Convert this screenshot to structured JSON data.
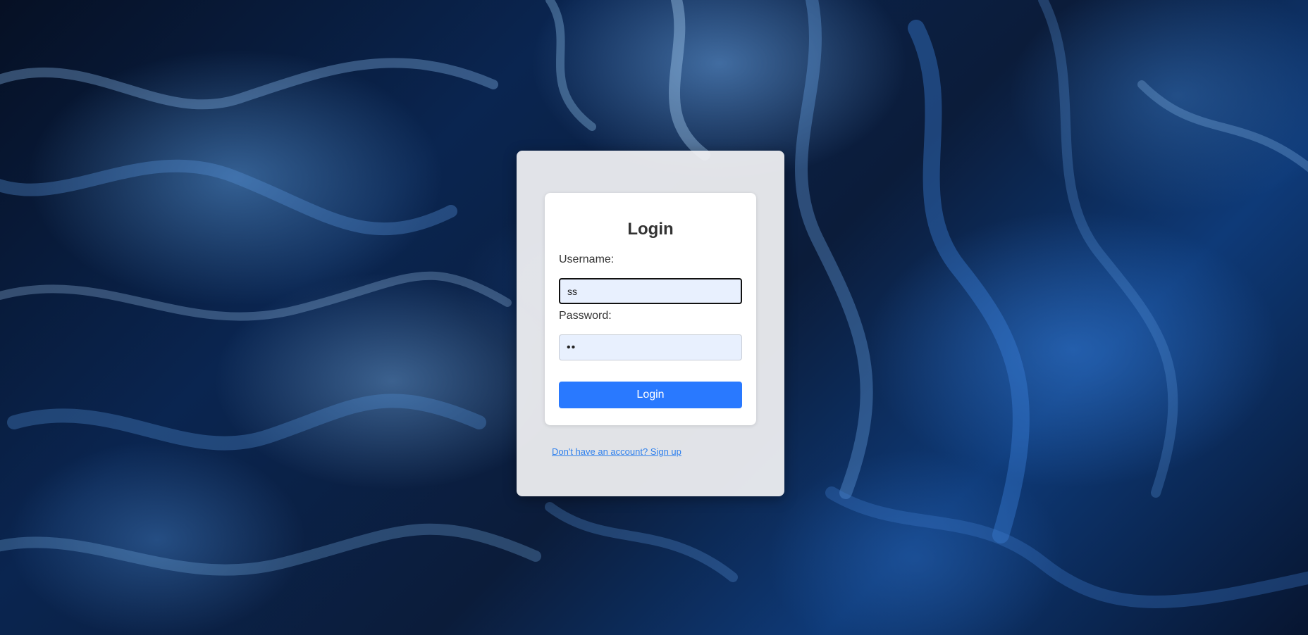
{
  "page": {
    "background_theme": "dark blue marbled fluid art",
    "colors": {
      "accent": "#2979ff",
      "link": "#2f80ed",
      "input_fill": "#e8f0fe",
      "text": "#333333"
    }
  },
  "login_form": {
    "title": "Login",
    "username_label": "Username:",
    "username_value": "ss",
    "password_label": "Password:",
    "password_value": "••",
    "submit_label": "Login"
  },
  "signup": {
    "link_text": "Don't have an account? Sign up"
  }
}
